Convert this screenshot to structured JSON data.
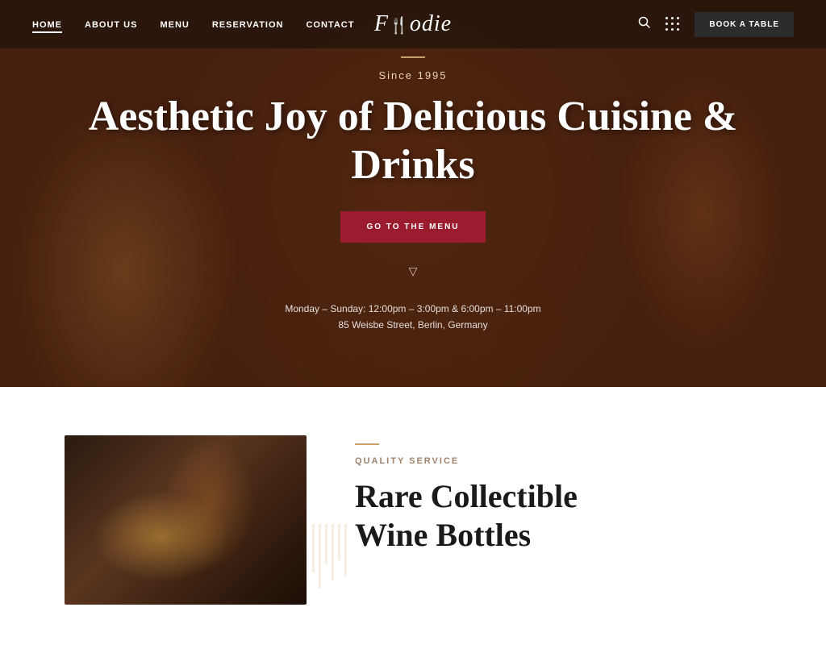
{
  "nav": {
    "links": [
      {
        "label": "Home",
        "active": true
      },
      {
        "label": "About Us",
        "active": false
      },
      {
        "label": "Menu",
        "active": false
      },
      {
        "label": "Reservation",
        "active": false
      },
      {
        "label": "Contact",
        "active": false
      }
    ],
    "logo": "Foodie",
    "book_label": "Book A Table"
  },
  "hero": {
    "line_decor": "—",
    "since": "Since 1995",
    "title": "Aesthetic Joy of Delicious Cuisine & Drinks",
    "cta_label": "Go To The Menu",
    "hours": "Monday – Sunday: 12:00pm – 3:00pm & 6:00pm – 11:00pm",
    "address": "85 Weisbe Street, Berlin, Germany"
  },
  "section": {
    "tag_line": "",
    "subtitle": "Quality Service",
    "title_line1": "Rare Collectible",
    "title_line2": "Wine Bottles"
  }
}
